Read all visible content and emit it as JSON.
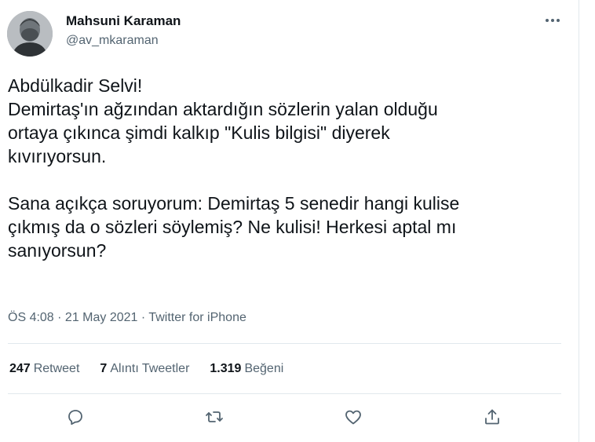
{
  "author": {
    "name": "Mahsuni Karaman",
    "handle": "@av_mkaraman"
  },
  "tweet": {
    "text": "Abdülkadir Selvi!\nDemirtaş'ın ağzından aktardığın sözlerin yalan olduğu\nortaya çıkınca şimdi kalkıp \"Kulis bilgisi\" diyerek\nkıvırıyorsun.\n\nSana açıkça soruyorum: Demirtaş 5 senedir hangi kulise\nçıkmış da o sözleri söylemiş? Ne kulisi! Herkesi aptal mı\nsanıyorsun?",
    "meta": "ÖS 4:08 · 21 May 2021 · Twitter for iPhone"
  },
  "stats": {
    "retweets_count": "247",
    "retweets_label": "Retweet",
    "quotes_count": "7",
    "quotes_label": "Alıntı Tweetler",
    "likes_count": "1.319",
    "likes_label": "Beğeni"
  },
  "actions": [
    "reply-icon",
    "retweet-icon",
    "like-icon",
    "share-icon"
  ],
  "colors": {
    "text": "#0f1419",
    "secondary": "#536471",
    "divider": "#e1e8ed"
  }
}
